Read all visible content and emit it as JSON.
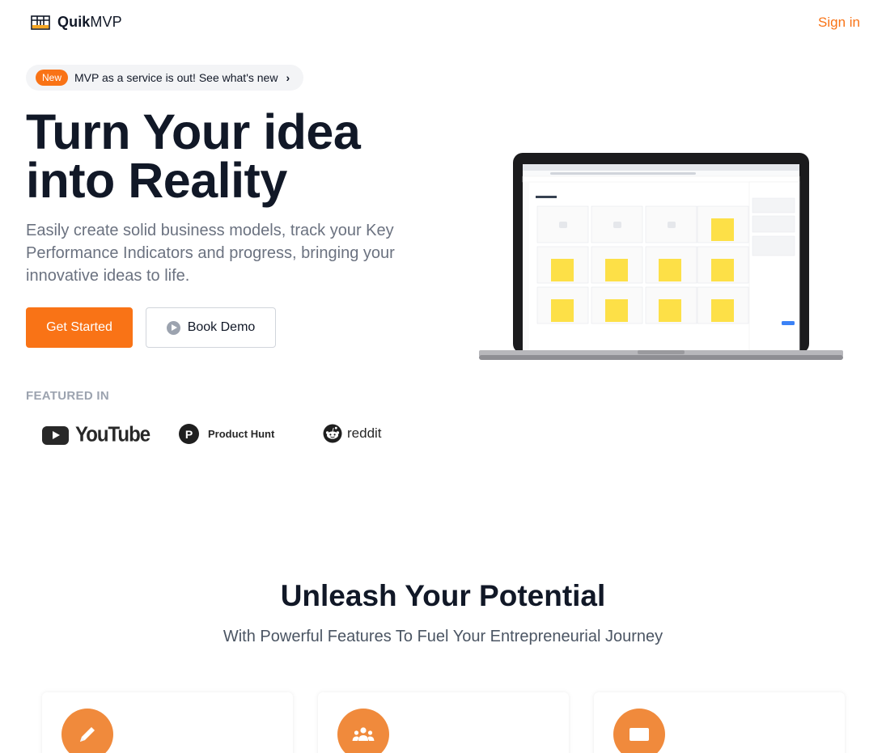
{
  "header": {
    "brand_bold": "Quik",
    "brand_regular": "MVP",
    "signin_label": "Sign in"
  },
  "announcement": {
    "badge": "New",
    "text": "MVP as a service is out! See what's new"
  },
  "hero": {
    "title_line1": "Turn Your idea",
    "title_line2": "into Reality",
    "subtitle": "Easily create solid business models, track your Key Performance Indicators and progress, bringing your innovative ideas to life.",
    "primary_cta": "Get Started",
    "secondary_cta": "Book Demo"
  },
  "featured": {
    "heading": "FEATURED IN",
    "brands": [
      "YouTube",
      "Product Hunt",
      "reddit"
    ],
    "product_hunt_letter": "P"
  },
  "features": {
    "title": "Unleash Your Potential",
    "subtitle": "With Powerful Features To Fuel Your Entrepreneurial Journey",
    "cards": [
      {
        "icon": "pencil-icon"
      },
      {
        "icon": "users-icon"
      },
      {
        "icon": "credit-card-icon"
      }
    ]
  },
  "colors": {
    "accent": "#f97316",
    "icon_circle": "#f08a3c",
    "heading": "#111827",
    "muted": "#6b7280"
  }
}
